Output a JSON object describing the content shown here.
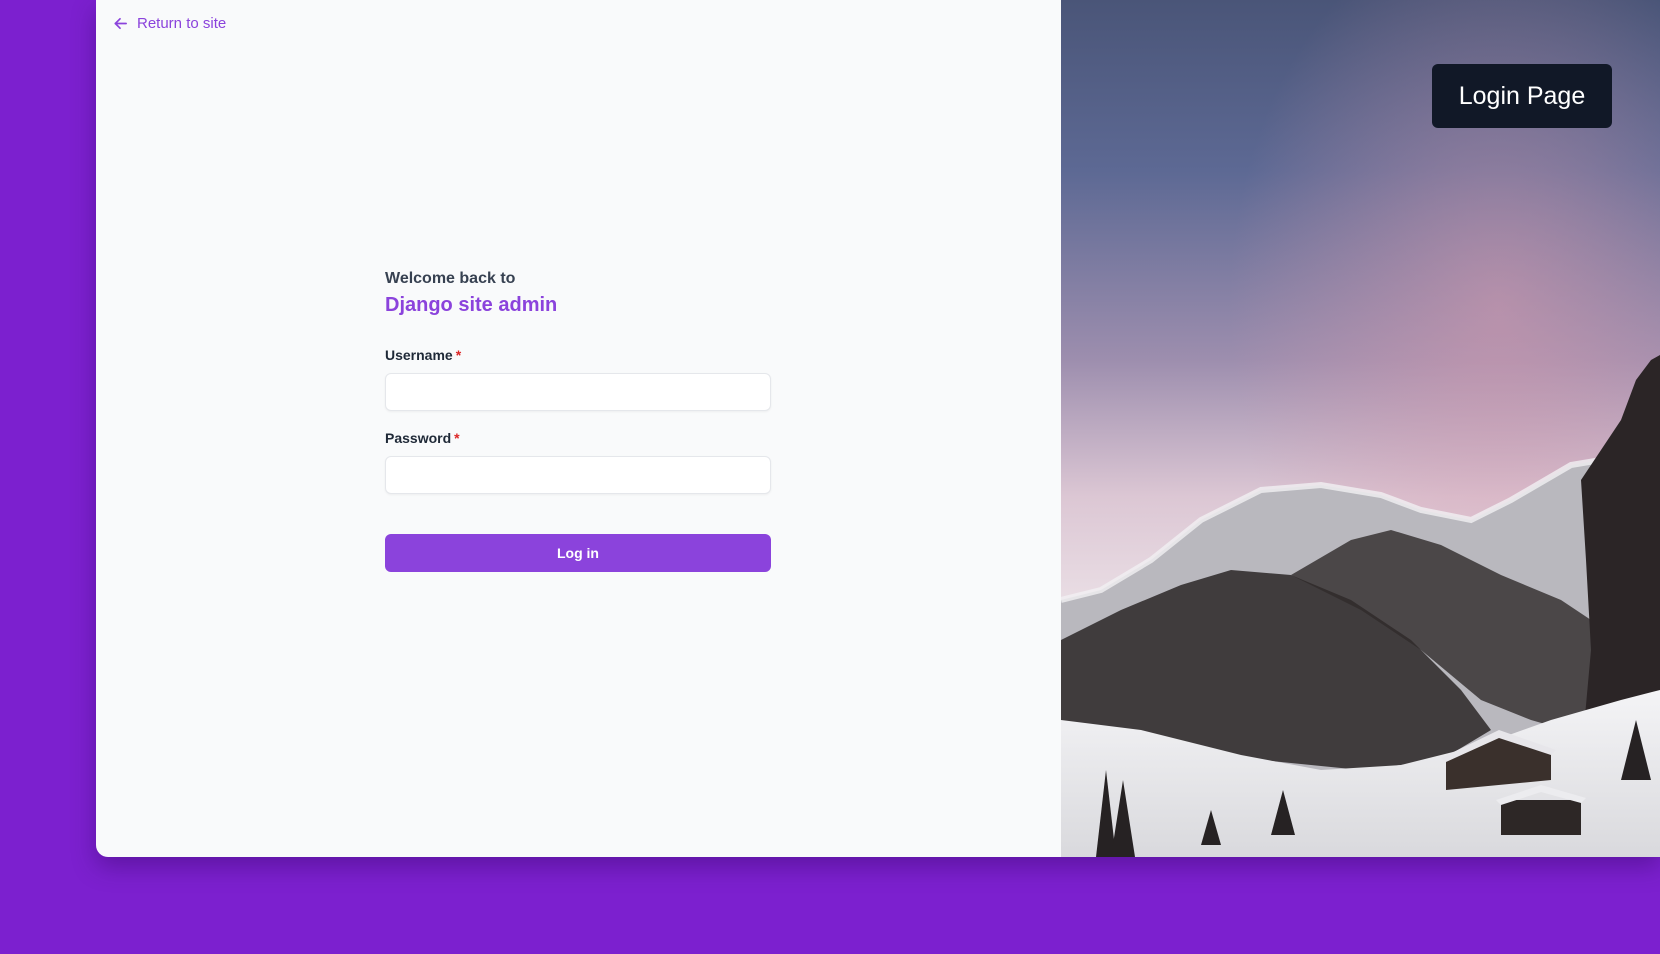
{
  "nav": {
    "return_label": "Return to site",
    "return_icon": "arrow-left-icon"
  },
  "login": {
    "welcome": "Welcome back to",
    "site_name": "Django site admin",
    "username_label": "Username",
    "password_label": "Password",
    "required_mark": "*",
    "username_value": "",
    "password_value": "",
    "submit_label": "Log in"
  },
  "overlay": {
    "page_label": "Login Page"
  },
  "colors": {
    "accent": "#8b43dc",
    "frame_background": "#7c20cf",
    "required": "#dc2626",
    "label_badge": "#111827"
  }
}
